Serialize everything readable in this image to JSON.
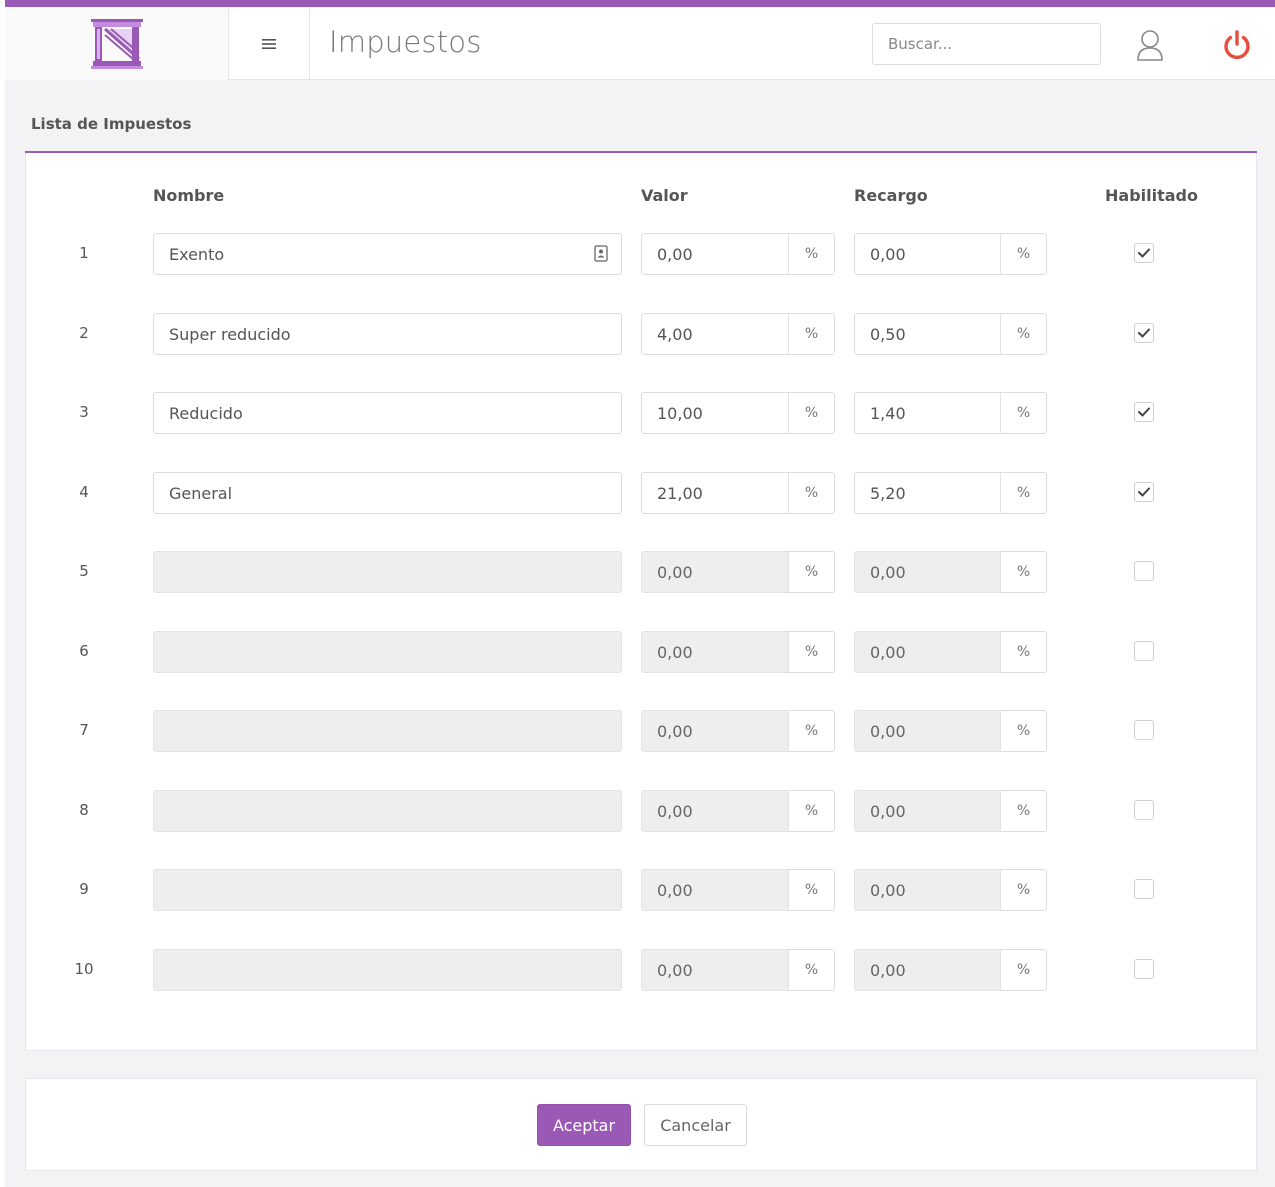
{
  "header": {
    "title": "Impuestos",
    "search_placeholder": "Buscar...",
    "menu_icon": "hamburger-icon",
    "user_icon": "user-icon",
    "power_icon": "power-icon",
    "accent_color": "#9b59b6",
    "power_color": "#e74c3c"
  },
  "panel": {
    "title": "Lista de Impuestos",
    "columns": {
      "nombre": "Nombre",
      "valor": "Valor",
      "recargo": "Recargo",
      "habilitado": "Habilitado"
    },
    "percent_symbol": "%",
    "rows": [
      {
        "num": "1",
        "nombre": "Exento",
        "valor": "0,00",
        "recargo": "0,00",
        "habilitado": true,
        "enabled": true
      },
      {
        "num": "2",
        "nombre": "Super reducido",
        "valor": "4,00",
        "recargo": "0,50",
        "habilitado": true,
        "enabled": true
      },
      {
        "num": "3",
        "nombre": "Reducido",
        "valor": "10,00",
        "recargo": "1,40",
        "habilitado": true,
        "enabled": true
      },
      {
        "num": "4",
        "nombre": "General",
        "valor": "21,00",
        "recargo": "5,20",
        "habilitado": true,
        "enabled": true
      },
      {
        "num": "5",
        "nombre": "",
        "valor": "0,00",
        "recargo": "0,00",
        "habilitado": false,
        "enabled": false
      },
      {
        "num": "6",
        "nombre": "",
        "valor": "0,00",
        "recargo": "0,00",
        "habilitado": false,
        "enabled": false
      },
      {
        "num": "7",
        "nombre": "",
        "valor": "0,00",
        "recargo": "0,00",
        "habilitado": false,
        "enabled": false
      },
      {
        "num": "8",
        "nombre": "",
        "valor": "0,00",
        "recargo": "0,00",
        "habilitado": false,
        "enabled": false
      },
      {
        "num": "9",
        "nombre": "",
        "valor": "0,00",
        "recargo": "0,00",
        "habilitado": false,
        "enabled": false
      },
      {
        "num": "10",
        "nombre": "",
        "valor": "0,00",
        "recargo": "0,00",
        "habilitado": false,
        "enabled": false
      }
    ]
  },
  "footer": {
    "accept_label": "Aceptar",
    "cancel_label": "Cancelar"
  }
}
